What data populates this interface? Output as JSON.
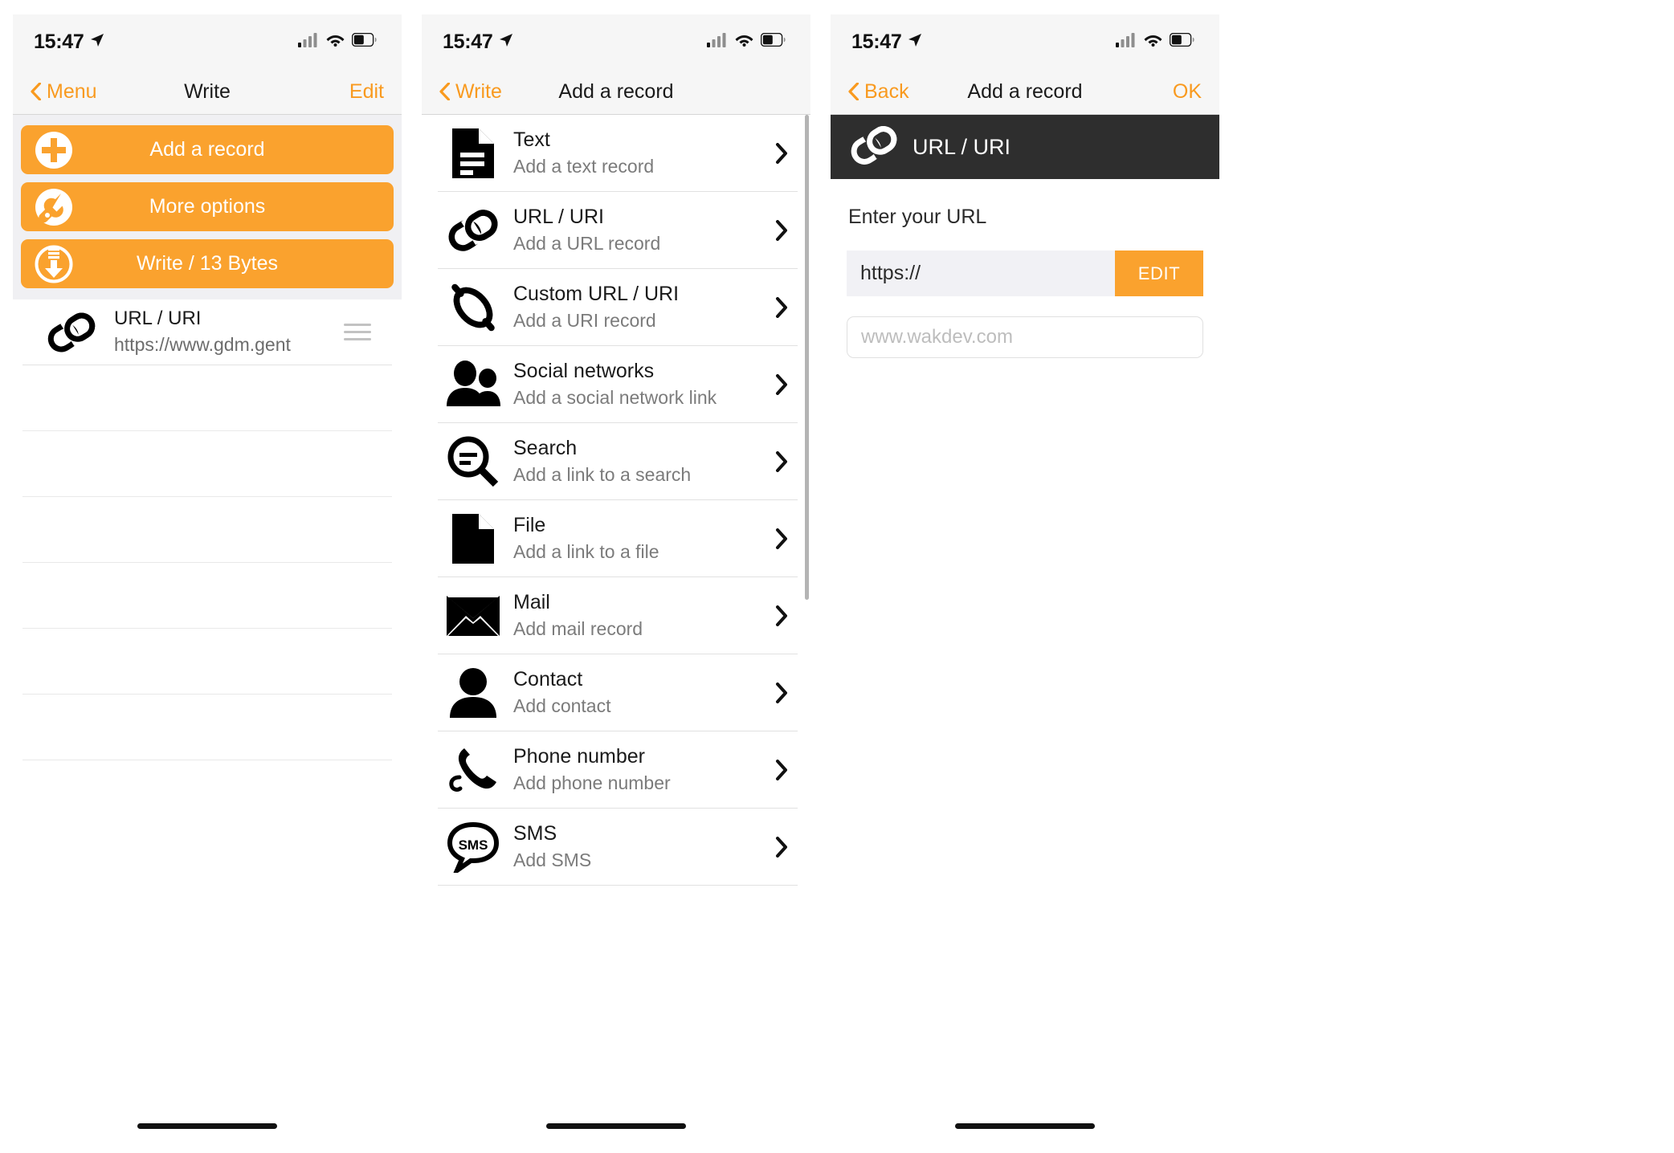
{
  "status": {
    "time": "15:47",
    "location_icon": "location-arrow-icon",
    "cellular_icon": "cellular-bars-icon",
    "wifi_icon": "wifi-icon",
    "battery_icon": "battery-icon"
  },
  "screen1": {
    "nav": {
      "back_label": "Menu",
      "title": "Write",
      "right_label": "Edit"
    },
    "actions": [
      {
        "label": "Add a record",
        "icon": "plus-circle-icon"
      },
      {
        "label": "More options",
        "icon": "wrench-circle-icon"
      },
      {
        "label": "Write / 13 Bytes",
        "icon": "download-circle-icon"
      }
    ],
    "records": [
      {
        "title": "URL / URI",
        "subtitle": "https://www.gdm.gent",
        "icon": "link-icon"
      }
    ],
    "empty_row_count": 6
  },
  "screen2": {
    "nav": {
      "back_label": "Write",
      "title": "Add a record",
      "right_label": ""
    },
    "items": [
      {
        "title": "Text",
        "subtitle": "Add a text record",
        "icon": "document-icon"
      },
      {
        "title": "URL / URI",
        "subtitle": "Add a URL record",
        "icon": "link-icon"
      },
      {
        "title": "Custom URL / URI",
        "subtitle": "Add a URI record",
        "icon": "custom-link-icon"
      },
      {
        "title": "Social networks",
        "subtitle": "Add a social network link",
        "icon": "people-icon"
      },
      {
        "title": "Search",
        "subtitle": "Add a link to a search",
        "icon": "search-icon"
      },
      {
        "title": "File",
        "subtitle": "Add a link to a file",
        "icon": "file-icon"
      },
      {
        "title": "Mail",
        "subtitle": "Add mail record",
        "icon": "envelope-icon"
      },
      {
        "title": "Contact",
        "subtitle": "Add contact",
        "icon": "person-icon"
      },
      {
        "title": "Phone number",
        "subtitle": "Add phone number",
        "icon": "phone-icon"
      },
      {
        "title": "SMS",
        "subtitle": "Add SMS",
        "icon": "sms-bubble-icon"
      }
    ],
    "chevron_icon": "chevron-right-icon"
  },
  "screen3": {
    "nav": {
      "back_label": "Back",
      "title": "Add a record",
      "right_label": "OK"
    },
    "banner": {
      "label": "URL / URI",
      "icon": "link-icon"
    },
    "form_label": "Enter your URL",
    "url_prefix": "https://",
    "edit_button": "EDIT",
    "url_placeholder": "www.wakdev.com",
    "url_value": ""
  },
  "colors": {
    "accent": "#faa22e",
    "banner": "#2e2e2e",
    "bar": "#f6f6f6",
    "field": "#f1f1f5"
  }
}
